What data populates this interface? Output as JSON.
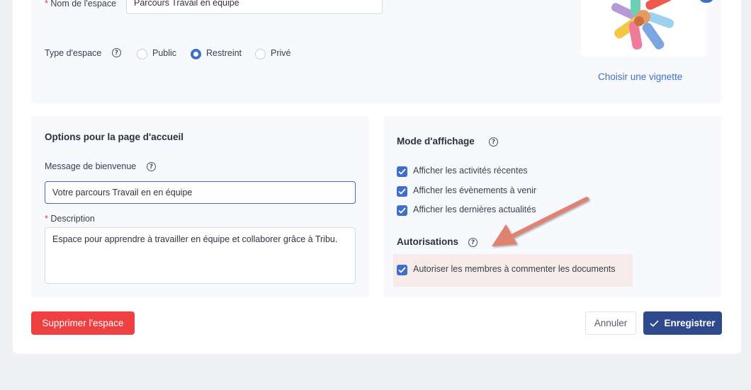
{
  "space": {
    "name_label": "Nom de l'espace",
    "name_value": "Parcours Travail en équipe",
    "type_label": "Type d'espace",
    "type_options": [
      {
        "label": "Public",
        "selected": false
      },
      {
        "label": "Restreint",
        "selected": true
      },
      {
        "label": "Privé",
        "selected": false
      }
    ],
    "choose_thumbnail": "Choisir une vignette"
  },
  "home": {
    "title": "Options pour la page d'accueil",
    "welcome_label": "Message de bienvenue",
    "welcome_value": "Votre parcours Travail en en équipe",
    "description_label": "Description",
    "description_value": "Espace pour apprendre à travailler en équipe et collaborer grâce à Tribu."
  },
  "display": {
    "title": "Mode d'affichage",
    "options": [
      {
        "label": "Afficher les activités récentes",
        "checked": true
      },
      {
        "label": "Afficher les évènements à venir",
        "checked": true
      },
      {
        "label": "Afficher les dernières actualités",
        "checked": true
      }
    ]
  },
  "permissions": {
    "title": "Autorisations",
    "options": [
      {
        "label": "Autoriser les membres à commenter les documents",
        "checked": true
      }
    ]
  },
  "actions": {
    "delete": "Supprimer l'espace",
    "cancel": "Annuler",
    "save": "Enregistrer"
  },
  "colors": {
    "accent": "#3f6fc7",
    "primary_button": "#2e4a8c",
    "danger": "#ee4040",
    "highlight": "#f6ebe9",
    "annotation_arrow": "#e0826f"
  },
  "icons": [
    "help-icon",
    "checkmark-icon",
    "annotation-arrow"
  ]
}
